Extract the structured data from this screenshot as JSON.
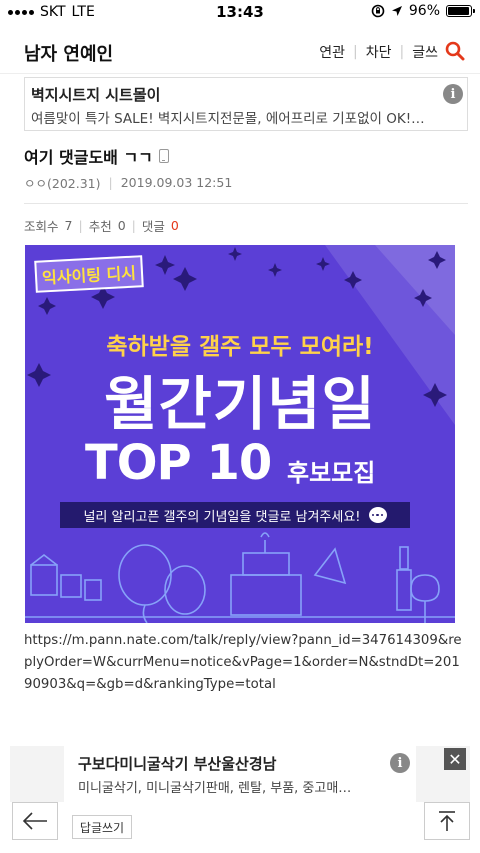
{
  "status_bar": {
    "carrier": "SKT",
    "network": "LTE",
    "time": "13:43",
    "battery": "96%",
    "battery_level": 0.96
  },
  "header": {
    "board_title": "남자 연예인",
    "nav": [
      "연관",
      "차단",
      "글쓰"
    ],
    "search_icon": "search-icon"
  },
  "top_ad": {
    "title": "벽지시트지 시트몰이",
    "description": "여름맞이 특가 SALE! 벽지시트지전문몰, 에어프리로 기포없이 OK!…",
    "info_icon": "i"
  },
  "post": {
    "title": "여기 댓글도배 ㄱㄱ",
    "author": "ㅇㅇ(202.31)",
    "date": "2019.09.03 12:51",
    "views_label": "조회수",
    "views": "7",
    "recommend_label": "추천",
    "recommend": "0",
    "comments_label": "댓글",
    "comments": "0"
  },
  "banner": {
    "logo": "익사이팅 디시",
    "subtitle": "축하받을 갤주 모두 모여라!",
    "main_title": "월간기념일",
    "top10": "TOP 10",
    "recruit": "후보모집",
    "caption": "널리 알리고픈 갤주의 기념일을 댓글로 남겨주세요!",
    "colors": {
      "background": "#5b3fd6",
      "accent": "#ffd24a"
    }
  },
  "body_url": "https://m.pann.nate.com/talk/reply/view?pann_id=347614309&replyOrder=W&currMenu=notice&vPage=1&order=N&stndDt=20190903&q=&gb=d&rankingType=total",
  "bottom_ad": {
    "title": "구보다미니굴삭기 부산울산경남",
    "description": "미니굴삭기, 미니굴삭기판매, 렌탈, 부품, 중고매…",
    "info_icon": "i",
    "close_icon": "✕"
  },
  "bottom_nav": {
    "back_icon": "←",
    "reply_label": "답글쓰기",
    "top_icon": "⤒"
  }
}
